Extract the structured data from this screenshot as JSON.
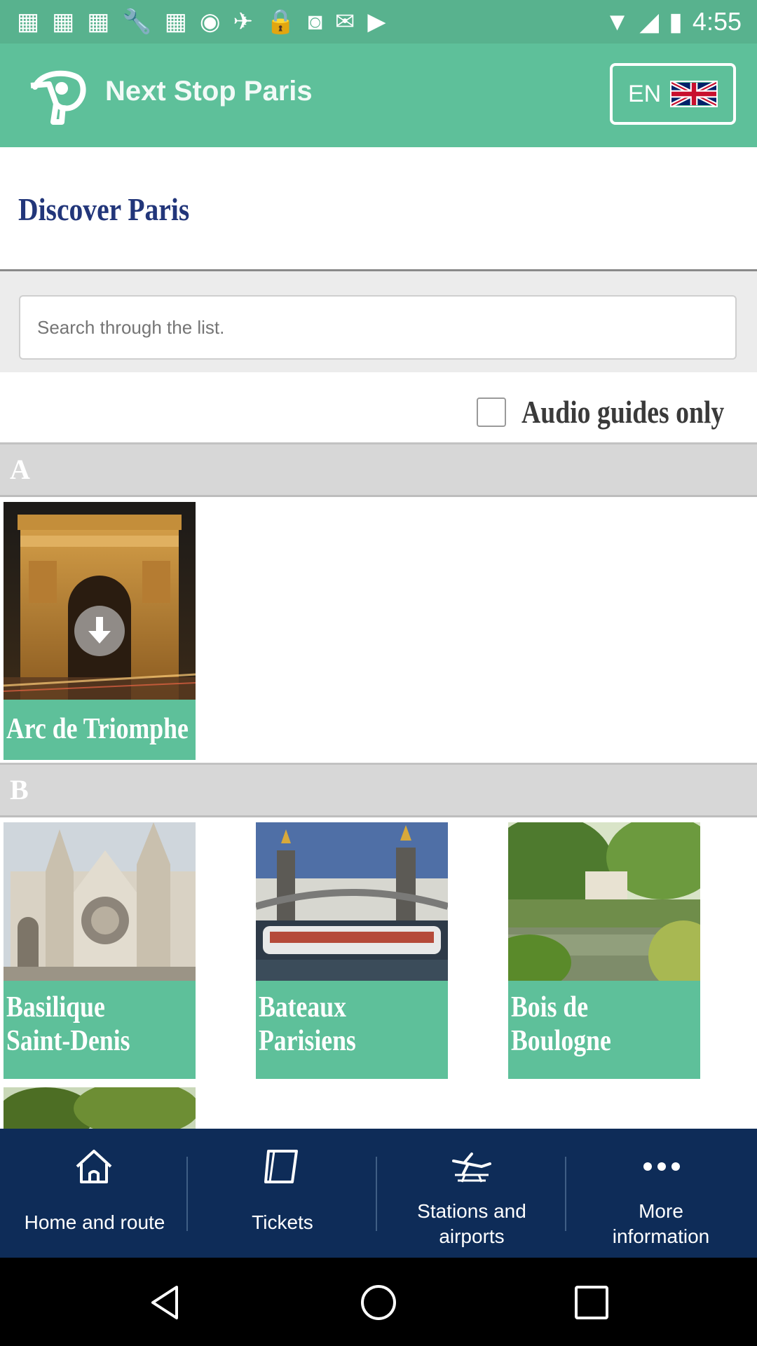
{
  "status_bar": {
    "time": "4:55",
    "notification_icons": [
      "fake-gps-icon",
      "flipboard-icon",
      "flipboard-icon",
      "wrench-icon",
      "flipboard-icon",
      "sync-icon",
      "satellite-icon",
      "lock-icon",
      "robot-icon",
      "inbox-icon",
      "youtube-icon"
    ]
  },
  "app_bar": {
    "title": "Next Stop Paris",
    "language": "EN"
  },
  "page": {
    "heading": "Discover Paris"
  },
  "search": {
    "placeholder": "Search through the list."
  },
  "filter": {
    "label": "Audio guides only",
    "checked": false
  },
  "sections": [
    {
      "letter": "A",
      "items": [
        {
          "name": "Arc de Triomphe",
          "downloadable": true
        }
      ]
    },
    {
      "letter": "B",
      "items": [
        {
          "line1": "Basilique",
          "line2": "Saint-Denis"
        },
        {
          "line1": "Bateaux",
          "line2": "Parisiens"
        },
        {
          "line1": "Bois de",
          "line2": "Boulogne"
        }
      ]
    }
  ],
  "bottom_nav": {
    "home": "Home and route",
    "tickets": "Tickets",
    "stations_line1": "Stations and",
    "stations_line2": "airports",
    "more_line1": "More",
    "more_line2": "information"
  },
  "colors": {
    "primary": "#5EC09A",
    "status_bar": "#58B28E",
    "heading_text": "#22367A",
    "nav_background": "#0E2C58",
    "section_header": "#D7D7D7"
  }
}
